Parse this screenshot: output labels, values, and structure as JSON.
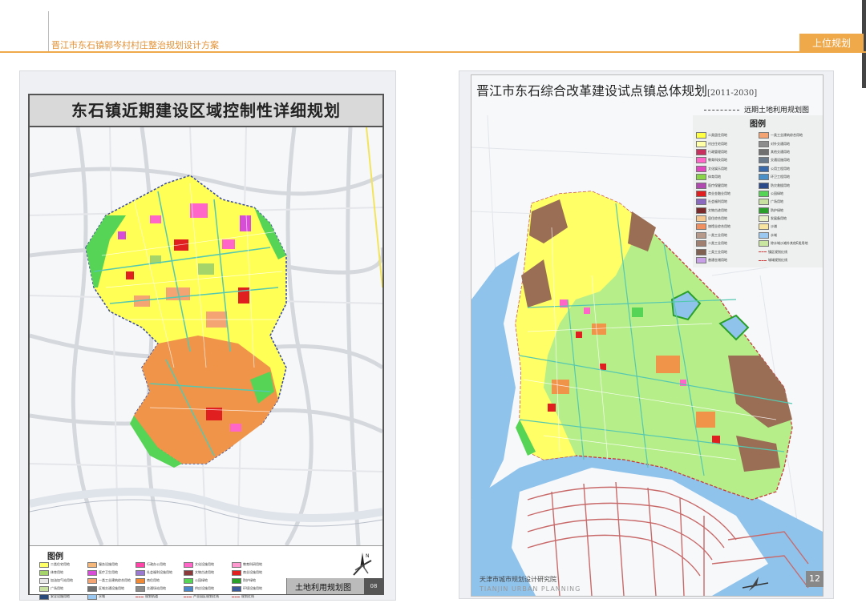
{
  "header": {
    "doc_title": "晋江市东石镇郭岑村村庄整治规划设计方案",
    "section_tab": "上位规划"
  },
  "left_map": {
    "title": "东石镇近期建设区域控制性详细规划",
    "map_label": "土地利用规划图",
    "page_number": "08",
    "legend_title": "图例",
    "legend": [
      {
        "label": "二类住宅用地",
        "color": "#ffff66"
      },
      {
        "label": "服务设施用地",
        "color": "#f5b87a"
      },
      {
        "label": "行政办公用地",
        "color": "#ff44a8"
      },
      {
        "label": "文化设施用地",
        "color": "#ff66c8"
      },
      {
        "label": "教育科研用地",
        "color": "#ff9ad0"
      },
      {
        "label": "体育用地",
        "color": "#a5d46a"
      },
      {
        "label": "医疗卫生用地",
        "color": "#d84dd8"
      },
      {
        "label": "社会福利设施用地",
        "color": "#9a7ad0"
      },
      {
        "label": "文物古迹用地",
        "color": "#8a3a3a"
      },
      {
        "label": "商业设施用地",
        "color": "#e02020"
      },
      {
        "label": "加油加气站用地",
        "color": "#e8e8e8"
      },
      {
        "label": "一类工业建筑综合用地",
        "color": "#f4a472"
      },
      {
        "label": "商住用地",
        "color": "#f08a36"
      },
      {
        "label": "公园绿地",
        "color": "#55d455"
      },
      {
        "label": "防护绿地",
        "color": "#2aa02a"
      },
      {
        "label": "广场用地",
        "color": "#c8e0a0"
      },
      {
        "label": "区域交通设施用地",
        "color": "#707070"
      },
      {
        "label": "交通场站用地",
        "color": "#8c8c8c"
      },
      {
        "label": "供应设施用地",
        "color": "#4a86c8"
      },
      {
        "label": "环境设施用地",
        "color": "#3a5a9a"
      },
      {
        "label": "安全设施用地",
        "color": "#2a4a7a"
      },
      {
        "label": "水域",
        "color": "#9ac8f0"
      },
      {
        "label": "规划轨道",
        "color": "line"
      },
      {
        "label": "产业园区规划红线",
        "color": "line"
      },
      {
        "label": "规划红线",
        "color": "line"
      }
    ]
  },
  "right_map": {
    "title": "晋江市东石综合改革建设试点镇总体规划",
    "years": "[2011-2030]",
    "subtitle": "远期土地利用规划图",
    "legend_title": "图例",
    "institute": "天津市城市规划设计研究院",
    "institute_en": "TIANJIN URBAN PLANNING",
    "page_number": "12",
    "legend": [
      {
        "label": "二类居住用地",
        "color": "#ffff44"
      },
      {
        "label": "一类工业建筑综合用地",
        "color": "#f4a472"
      },
      {
        "label": "村庄住宅用地",
        "color": "#ffffa8"
      },
      {
        "label": "对外交通用地",
        "color": "#8c8c8c"
      },
      {
        "label": "行政管理用地",
        "color": "#c83060"
      },
      {
        "label": "其他交通用地",
        "color": "#707070"
      },
      {
        "label": "教育科技用地",
        "color": "#ff66c8"
      },
      {
        "label": "交通设施用地",
        "color": "#6a7a8a"
      },
      {
        "label": "文化娱乐用地",
        "color": "#e048c0"
      },
      {
        "label": "公用工程用地",
        "color": "#3a6aaa"
      },
      {
        "label": "体育用地",
        "color": "#8ad44a"
      },
      {
        "label": "环卫工程用地",
        "color": "#4a90c8"
      },
      {
        "label": "医疗保健用地",
        "color": "#b04ab0"
      },
      {
        "label": "防灾救援用地",
        "color": "#2a4a8a"
      },
      {
        "label": "商业金融业用地",
        "color": "#e02020"
      },
      {
        "label": "公园绿地",
        "color": "#55d455"
      },
      {
        "label": "社会福利用地",
        "color": "#8a6ac0"
      },
      {
        "label": "广场用地",
        "color": "#c8e0a0"
      },
      {
        "label": "文物古迹用地",
        "color": "#7a2a2a"
      },
      {
        "label": "防护绿地",
        "color": "#2aa02a"
      },
      {
        "label": "居住综合用地",
        "color": "#f4c890"
      },
      {
        "label": "发展备用地",
        "color": "#e8f0c8"
      },
      {
        "label": "旅馆业综合用地",
        "color": "#f09060"
      },
      {
        "label": "沙滩",
        "color": "#f8e6a0"
      },
      {
        "label": "一类工业用地",
        "color": "#b89a8a"
      },
      {
        "label": "水域",
        "color": "#9ac8f0"
      },
      {
        "label": "二类工业用地",
        "color": "#a08070"
      },
      {
        "label": "除水域沙滩外其他E类用地",
        "color": "#c8e6a0"
      },
      {
        "label": "三类工业用地",
        "color": "#806050"
      },
      {
        "label": "镇区规划红线",
        "color": "line"
      },
      {
        "label": "普通仓储用地",
        "color": "#c8a0e8"
      },
      {
        "label": "城域规划红线",
        "color": "line"
      }
    ]
  }
}
